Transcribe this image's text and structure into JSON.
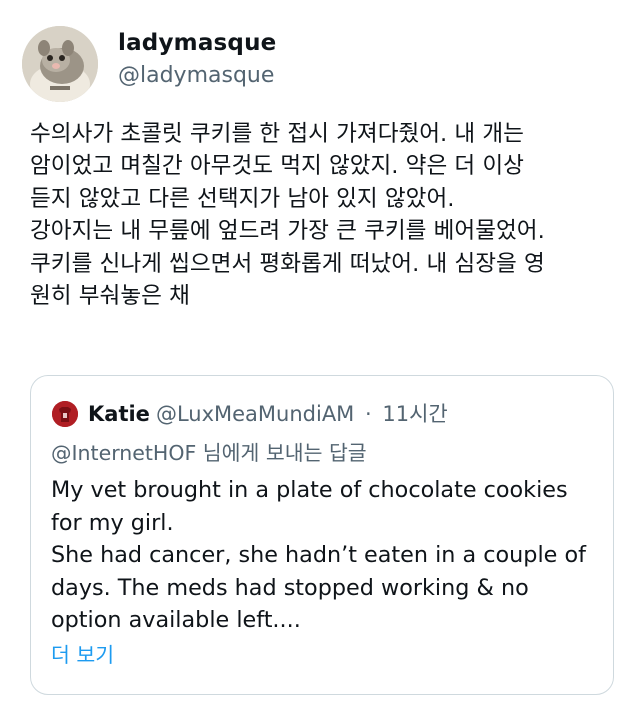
{
  "post": {
    "author_name": "ladymasque",
    "author_handle": "@ladymasque",
    "avatar_icon": "sugar-glider-avatar",
    "lines": [
      "수의사가 초콜릿 쿠키를 한 접시 가져다줬어. 내 개는",
      "암이었고 며칠간 아무것도 먹지 않았지. 약은 더 이상",
      "듣지 않았고 다른 선택지가 남아 있지 않았어.",
      "강아지는 내 무릎에 엎드려 가장 큰 쿠키를 베어물었어.",
      "쿠키를 신나게 씹으면서 평화롭게 떠났어. 내 심장을 영",
      "원히 부숴놓은 채"
    ]
  },
  "quote": {
    "author_name": "Katie",
    "author_handle": "@LuxMeaMundiAM",
    "separator": "·",
    "time": "11시간",
    "avatar_icon": "red-jersey-avatar",
    "reply_to": "@InternetHOF 님에게 보내는 답글",
    "lines": [
      "My vet brought in a plate of chocolate cookies",
      "for my girl.",
      "She had cancer, she hadn’t eaten in a couple of",
      "days. The meds had stopped working & no",
      "option available left...."
    ],
    "show_more": "더 보기"
  },
  "colors": {
    "text_primary": "#0f1419",
    "text_secondary": "#536471",
    "link": "#1d9bf0",
    "card_border": "#cfd9de",
    "quote_avatar_bg": "#b01e24"
  }
}
